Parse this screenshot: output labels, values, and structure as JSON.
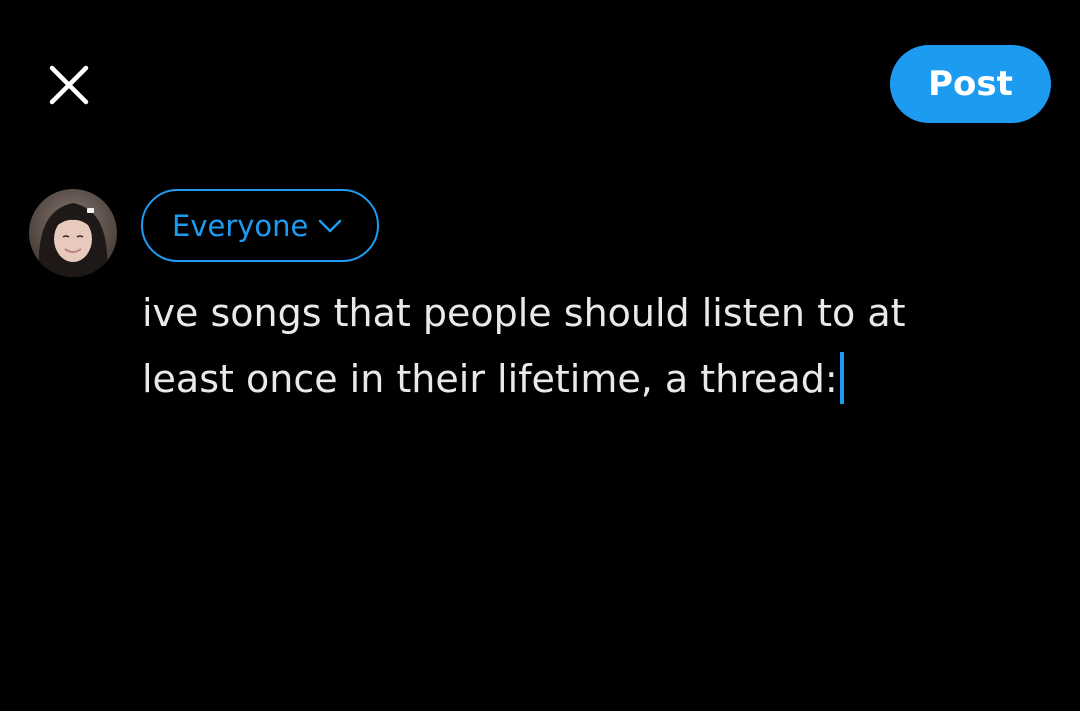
{
  "header": {
    "close_icon": "close-icon",
    "post_label": "Post"
  },
  "author": {
    "avatar_icon": "avatar"
  },
  "audience": {
    "label": "Everyone",
    "icon": "chevron-down-icon"
  },
  "composer": {
    "line1": "ive songs that people should listen to at",
    "line2": "least once in their lifetime, a thread:"
  },
  "colors": {
    "background": "#000000",
    "accent": "#1d9bf0",
    "text": "#e7e9ea"
  }
}
